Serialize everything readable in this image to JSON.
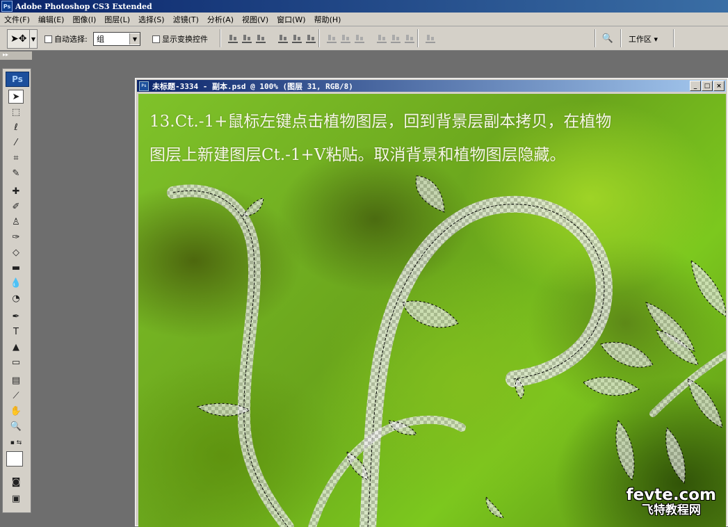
{
  "app": {
    "title": "Adobe Photoshop CS3 Extended",
    "icon": "ps-icon"
  },
  "menu": {
    "items": [
      {
        "label": "文件(F)"
      },
      {
        "label": "编辑(E)"
      },
      {
        "label": "图像(I)"
      },
      {
        "label": "图层(L)"
      },
      {
        "label": "选择(S)"
      },
      {
        "label": "滤镜(T)"
      },
      {
        "label": "分析(A)"
      },
      {
        "label": "视图(V)"
      },
      {
        "label": "窗口(W)"
      },
      {
        "label": "帮助(H)"
      }
    ]
  },
  "options": {
    "auto_select_label": "自动选择:",
    "auto_select_value": "组",
    "show_transform_label": "显示变换控件",
    "workspace_label": "工作区 ▾"
  },
  "toolbox": {
    "logo": "Ps"
  },
  "document": {
    "title": "未标题-3334 - 副本.psd @ 100% (图层 31, RGB/8)",
    "caption_line1": "13.Ct.-1+鼠标左键点击植物图层，回到背景层副本拷贝，在植物",
    "caption_line2": "图层上新建图层Ct.-1+V粘贴。取消背景和植物图层隐藏。"
  },
  "watermark": {
    "line1": "fevte.com",
    "line2": "飞特教程网"
  },
  "colors": {
    "titlebar": "#0a246a",
    "chrome": "#d4d0c8",
    "workspace_bg": "#6e6e6e",
    "canvas_green": "#7fc22a"
  }
}
